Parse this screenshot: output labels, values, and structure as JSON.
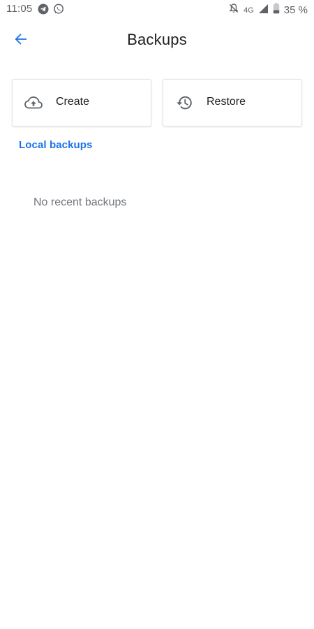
{
  "status_bar": {
    "time": "11:05",
    "network": "4G",
    "battery": "35 %",
    "left_icons": [
      "telegram-icon",
      "whatsapp-icon"
    ],
    "right_icons": [
      "notifications-off-icon",
      "signal-icon",
      "battery-icon"
    ]
  },
  "app_bar": {
    "title": "Backups",
    "back_icon": "arrow-back-icon"
  },
  "actions": {
    "create_label": "Create",
    "create_icon": "cloud-upload-icon",
    "restore_label": "Restore",
    "restore_icon": "history-icon"
  },
  "local_backups_label": "Local backups",
  "empty_message": "No recent backups",
  "colors": {
    "accent": "#1a73e8",
    "text_primary": "#202124",
    "text_secondary": "#70757a",
    "icon_gray": "#5f6368",
    "background": "#ffffff"
  }
}
